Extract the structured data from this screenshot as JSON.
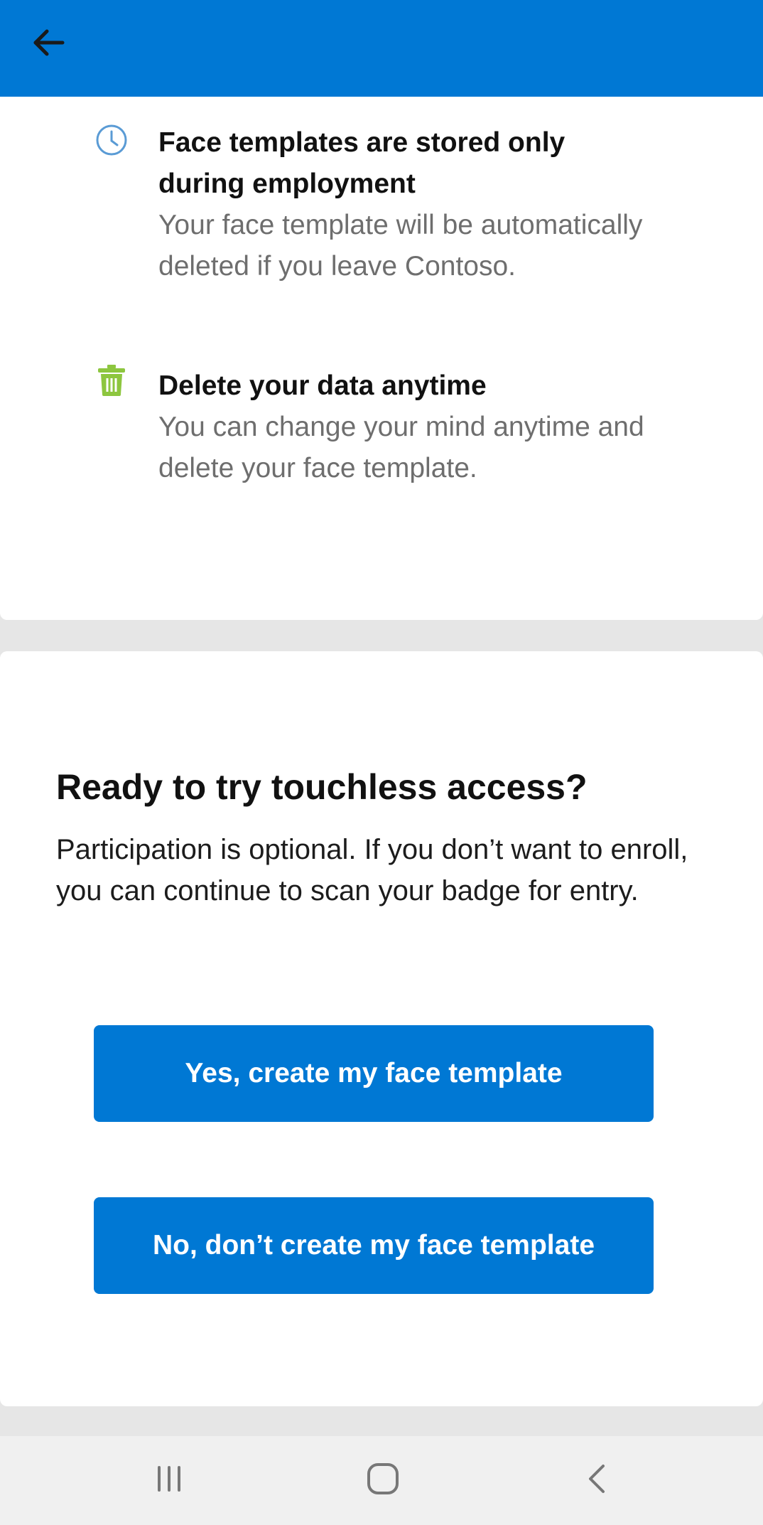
{
  "colors": {
    "accent": "#0078d4",
    "clock_icon": "#5a9bd5",
    "trash_icon": "#8dc63f"
  },
  "app_bar": {
    "back_icon": "arrow-left-icon"
  },
  "info_items": [
    {
      "icon": "clock-icon",
      "title": "Face templates are stored only during employment",
      "description": "Your face template will be automatically deleted if you leave Contoso."
    },
    {
      "icon": "trash-icon",
      "title": "Delete your data anytime",
      "description": "You can change your mind anytime and delete your face template."
    }
  ],
  "cta": {
    "heading": "Ready to try touchless access?",
    "body": "Participation is optional. If you don’t want to enroll, you can continue to scan your badge for entry.",
    "yes_label": "Yes, create my face template",
    "no_label": "No, don’t create my face template"
  },
  "system_nav": {
    "recents_icon": "recents-icon",
    "home_icon": "home-icon",
    "back_icon": "chevron-left-icon"
  }
}
